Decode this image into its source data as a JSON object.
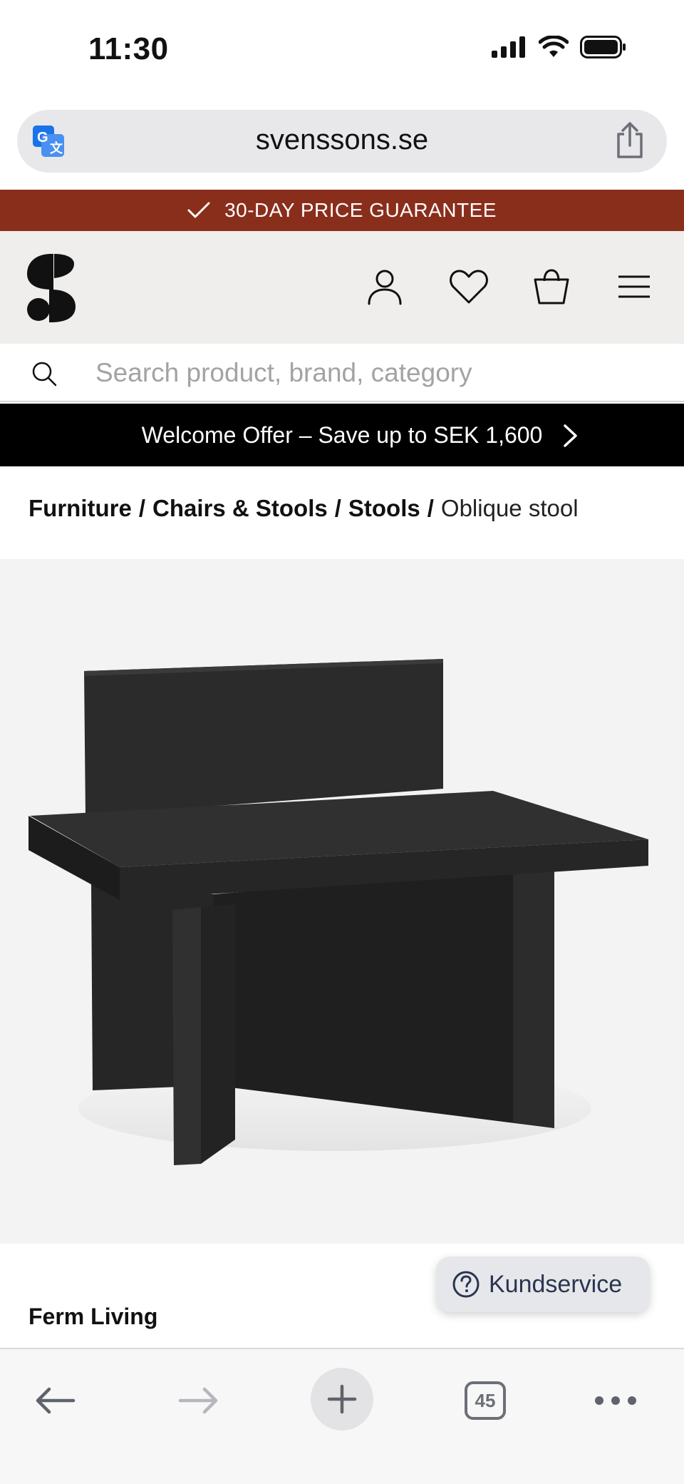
{
  "status_bar": {
    "time": "11:30"
  },
  "browser": {
    "url": "svenssons.se"
  },
  "guarantee_banner": {
    "text": "30-DAY PRICE GUARANTEE"
  },
  "search": {
    "placeholder": "Search product, brand, category"
  },
  "welcome_offer": {
    "text": "Welcome Offer – Save up to SEK 1,600"
  },
  "breadcrumb": {
    "items": [
      "Furniture",
      "Chairs & Stools",
      "Stools"
    ],
    "separator": "/",
    "current": "Oblique stool"
  },
  "product": {
    "brand": "Ferm Living"
  },
  "kundservice": {
    "label": "Kundservice"
  },
  "toolbar": {
    "tabs_count": "45"
  },
  "colors": {
    "banner_red": "#8a2e1c",
    "header_bg": "#efeeec",
    "welcome_bg": "#000000",
    "kundservice_text": "#2a3550"
  }
}
